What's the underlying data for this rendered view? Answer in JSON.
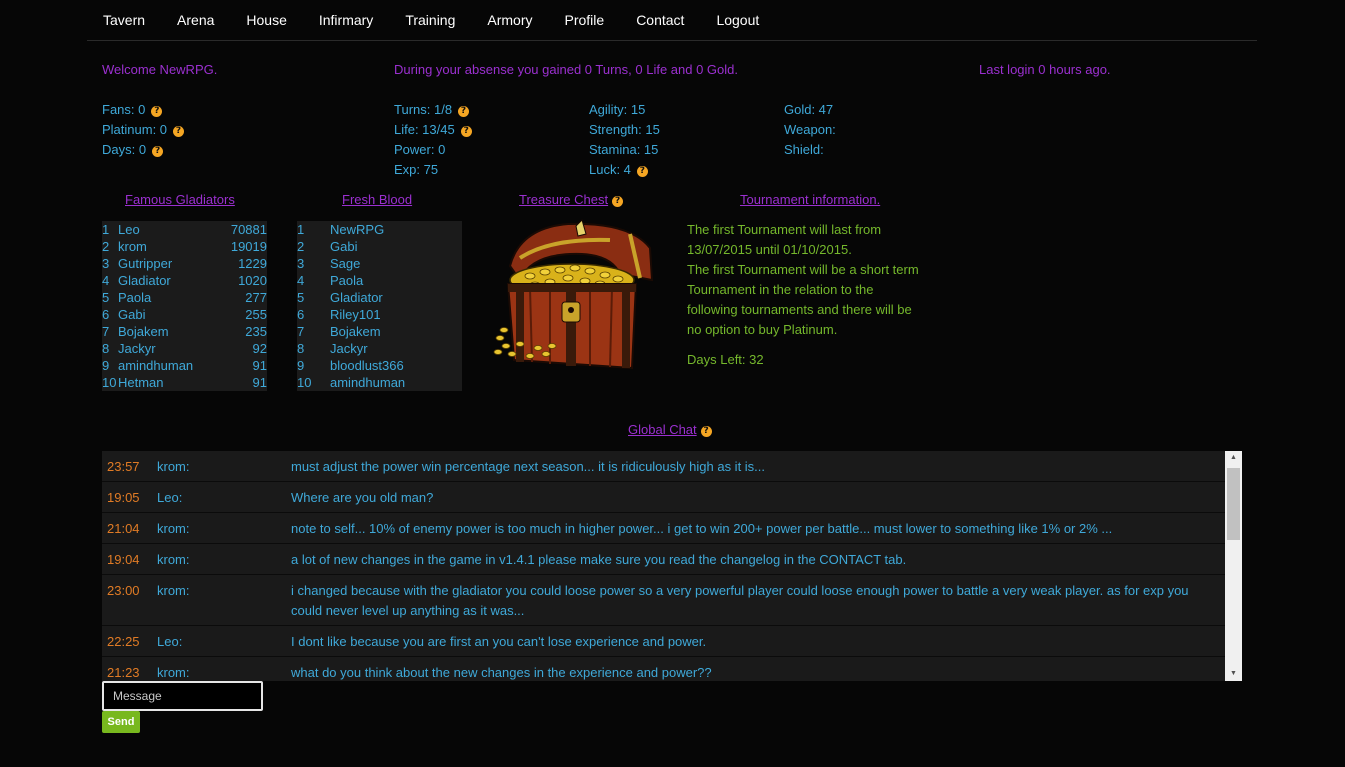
{
  "nav": [
    "Tavern",
    "Arena",
    "House",
    "Infirmary",
    "Training",
    "Armory",
    "Profile",
    "Contact",
    "Logout"
  ],
  "welcome": "Welcome NewRPG.",
  "absence": "During your absense you gained 0 Turns, 0 Life and 0 Gold.",
  "last_login": "Last login 0 hours ago.",
  "stats": {
    "fans": "Fans: 0",
    "platinum": "Platinum: 0",
    "days": "Days: 0",
    "turns": "Turns: 1/8",
    "life": "Life: 13/45",
    "power": "Power: 0",
    "exp": "Exp: 75",
    "agility": "Agility: 15",
    "strength": "Strength: 15",
    "stamina": "Stamina: 15",
    "luck": "Luck: 4",
    "gold": "Gold: 47",
    "weapon": "Weapon:",
    "shield": "Shield:"
  },
  "help_glyph": "?",
  "famous": {
    "title": "Famous Gladiators",
    "rows": [
      {
        "rank": "1",
        "name": "Leo",
        "score": "70881"
      },
      {
        "rank": "2",
        "name": "krom",
        "score": "19019"
      },
      {
        "rank": "3",
        "name": "Gutripper",
        "score": "1229"
      },
      {
        "rank": "4",
        "name": "Gladiator",
        "score": "1020"
      },
      {
        "rank": "5",
        "name": "Paola",
        "score": "277"
      },
      {
        "rank": "6",
        "name": "Gabi",
        "score": "255"
      },
      {
        "rank": "7",
        "name": "Bojakem",
        "score": "235"
      },
      {
        "rank": "8",
        "name": "Jackyr",
        "score": "92"
      },
      {
        "rank": "9",
        "name": "amindhuman",
        "score": "91"
      },
      {
        "rank": "10",
        "name": "Hetman",
        "score": "91"
      }
    ]
  },
  "fresh": {
    "title": "Fresh Blood",
    "rows": [
      {
        "rank": "1",
        "name": "NewRPG"
      },
      {
        "rank": "2",
        "name": "Gabi"
      },
      {
        "rank": "3",
        "name": "Sage"
      },
      {
        "rank": "4",
        "name": "Paola"
      },
      {
        "rank": "5",
        "name": "Gladiator"
      },
      {
        "rank": "6",
        "name": "Riley101"
      },
      {
        "rank": "7",
        "name": "Bojakem"
      },
      {
        "rank": "8",
        "name": "Jackyr"
      },
      {
        "rank": "9",
        "name": "bloodlust366"
      },
      {
        "rank": "10",
        "name": "amindhuman"
      }
    ]
  },
  "treasure": {
    "title": "Treasure Chest"
  },
  "tournament": {
    "title": "Tournament information.",
    "text": [
      "The first Tournament will last from",
      "13/07/2015 until 01/10/2015.",
      "The first Tournament will be a short term",
      "Tournament in the relation to the",
      "following tournaments and there will be",
      "no option to buy Platinum."
    ],
    "days_left": "Days Left: 32"
  },
  "chat": {
    "title": "Global Chat",
    "messages": [
      {
        "time": "23:57",
        "user": "krom:",
        "text": "must adjust the power win percentage next season... it is ridiculously high as it is..."
      },
      {
        "time": "19:05",
        "user": "Leo:",
        "text": "Where are you old man?"
      },
      {
        "time": "21:04",
        "user": "krom:",
        "text": "note to self... 10% of enemy power is too much in higher power... i get to win 200+ power per battle... must lower to something like 1% or 2% ..."
      },
      {
        "time": "19:04",
        "user": "krom:",
        "text": "a lot of new changes in the game in v1.4.1 please make sure you read the changelog in the CONTACT tab."
      },
      {
        "time": "23:00",
        "user": "krom:",
        "text": "i changed because with the gladiator you could loose power so a very powerful player could loose enough power to battle a very weak player. as for exp you could never level up anything as it was..."
      },
      {
        "time": "22:25",
        "user": "Leo:",
        "text": "I dont like because you are first an you can't lose experience and power."
      },
      {
        "time": "21:23",
        "user": "krom:",
        "text": "what do you think about the new changes in the experience and power??"
      }
    ],
    "input_placeholder": "Message",
    "send_label": "Send"
  }
}
